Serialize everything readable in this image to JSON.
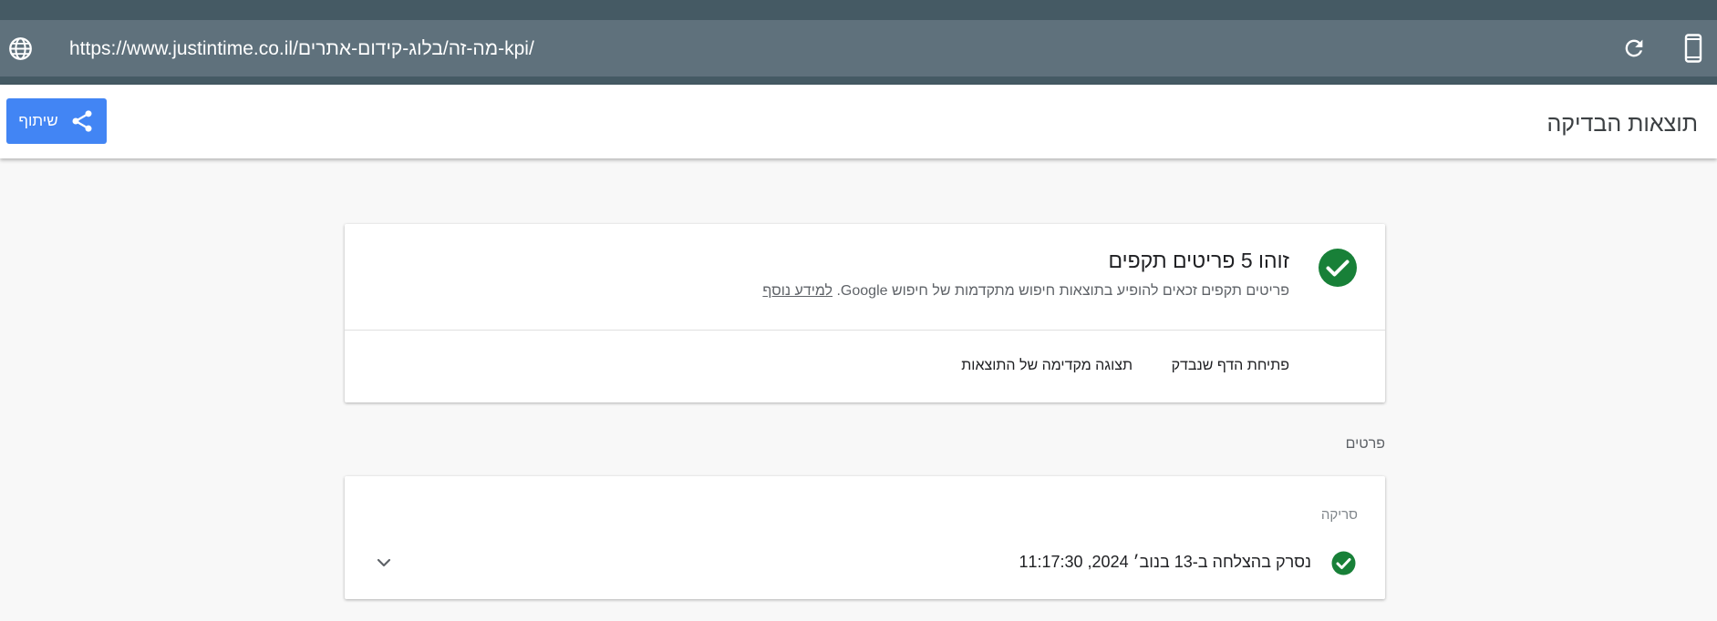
{
  "browser": {
    "url": "https://www.justintime.co.il/מה-זה/בלוג-קידום-אתרים-kpi/",
    "icons": {
      "left": "globe-icon",
      "reload": "reload-icon",
      "device": "mobile-device-icon"
    }
  },
  "header": {
    "title": "תוצאות הבדיקה",
    "share_label": "שיתוף"
  },
  "summary": {
    "headline": "זוהו 5 פריטים תקפים",
    "description": "פריטים תקפים זכאים להופיע בתוצאות חיפוש מתקדמות של חיפוש Google.",
    "learn_more": "למידע נוסף",
    "actions": [
      "פתיחת הדף שנבדק",
      "תצוגה מקדימה של התוצאות"
    ]
  },
  "details": {
    "section_label": "פרטים",
    "crawl_label": "סריקה",
    "crawl_status": "נסרק בהצלחה ב-13 בנוב׳ 2024, 11:17:30"
  },
  "colors": {
    "browser_dark": "#455a64",
    "browser_bar": "#5f717c",
    "accent_blue": "#4285f4",
    "success_green": "#188038"
  }
}
